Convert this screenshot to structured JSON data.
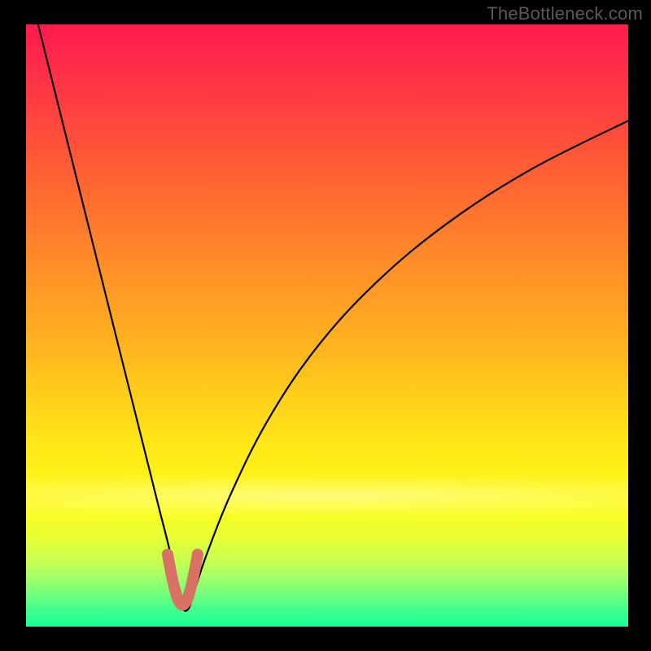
{
  "watermark": "TheBottleneck.com",
  "colors": {
    "marker": "#d77264",
    "curve": "#000000"
  },
  "chart_data": {
    "type": "line",
    "title": "",
    "xlabel": "",
    "ylabel": "",
    "xlim": [
      0,
      100
    ],
    "ylim": [
      0,
      100
    ],
    "grid": false,
    "series": [
      {
        "name": "bottleneck-curve",
        "x": [
          2,
          4,
          6,
          8,
          10,
          12,
          14,
          16,
          18,
          20,
          22,
          24,
          25,
          26,
          27,
          28,
          30,
          34,
          40,
          48,
          58,
          70,
          84,
          100
        ],
        "y": [
          100,
          92,
          84,
          76,
          68,
          60,
          52,
          44,
          36,
          28,
          20,
          12,
          6,
          3,
          3,
          6,
          12,
          22,
          34,
          46,
          57,
          67,
          76,
          84
        ]
      }
    ],
    "marker": {
      "name": "optimal-range",
      "x": [
        23.5,
        24.5,
        25.5,
        26.5,
        27.5,
        28.5
      ],
      "y": [
        12,
        7,
        4,
        4,
        7,
        12
      ]
    }
  }
}
